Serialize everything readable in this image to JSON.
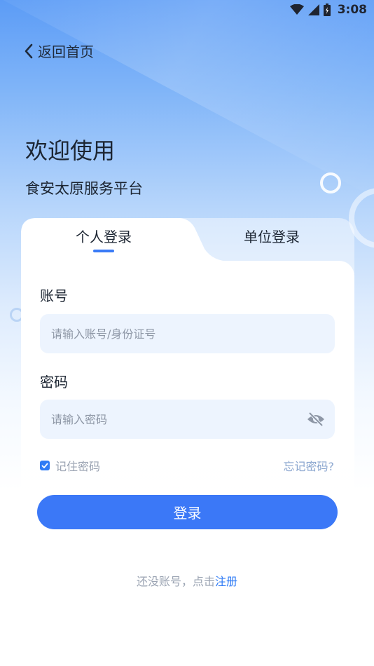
{
  "status_bar": {
    "time": "3:08"
  },
  "nav": {
    "back_label": "返回首页"
  },
  "welcome": {
    "title": "欢迎使用",
    "subtitle": "食安太原服务平台"
  },
  "tabs": [
    {
      "label": "个人登录",
      "active": true
    },
    {
      "label": "单位登录",
      "active": false
    }
  ],
  "form": {
    "account_label": "账号",
    "account_placeholder": "请输入账号/身份证号",
    "password_label": "密码",
    "password_placeholder": "请输入密码",
    "remember_label": "记住密码",
    "remember_checked": true,
    "forgot_label": "忘记密码?",
    "login_label": "登录"
  },
  "register": {
    "prompt": "还没账号，点击",
    "link": "注册"
  },
  "colors": {
    "accent": "#3b78f7",
    "field_bg": "#edf4fe"
  }
}
